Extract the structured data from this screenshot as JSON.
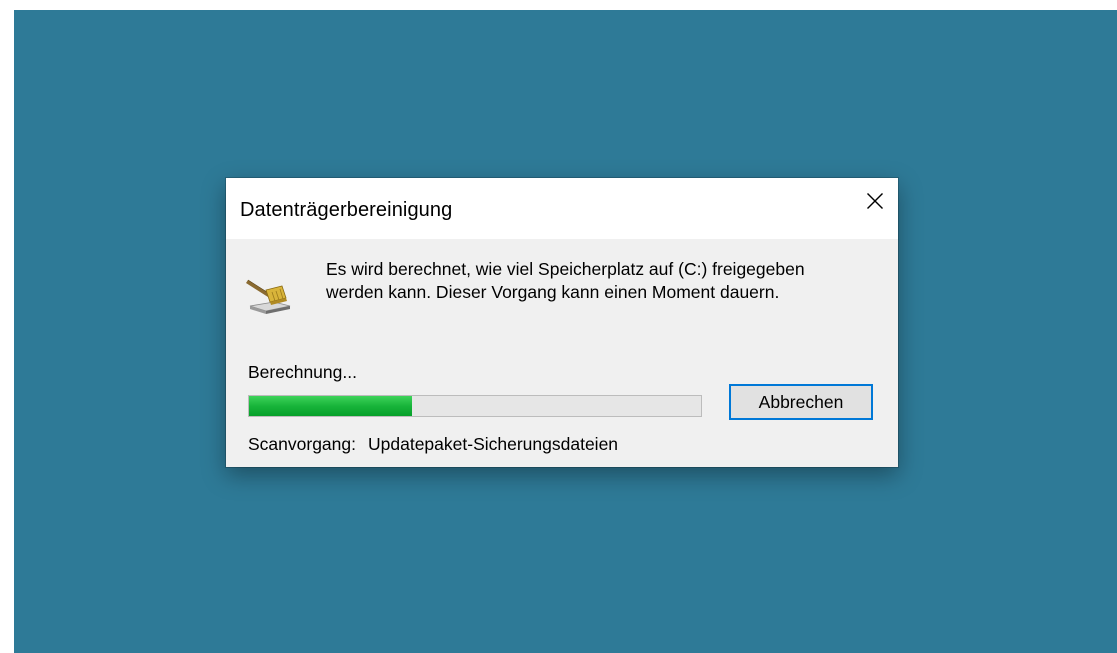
{
  "desktop": {
    "background_color": "#2e7a97"
  },
  "dialog": {
    "title": "Datenträgerbereinigung",
    "close_icon": "close-icon",
    "app_icon": "disk-cleanup-icon",
    "message": "Es wird berechnet, wie viel Speicherplatz auf  (C:) freigegeben werden kann. Dieser Vorgang kann einen Moment dauern.",
    "status_label": "Berechnung...",
    "progress_percent": 36,
    "progress_color": "#06a02a",
    "cancel_label": "Abbrechen",
    "accent_color": "#0078d7",
    "scan_label": "Scanvorgang:",
    "scan_value": "Updatepaket-Sicherungsdateien"
  }
}
